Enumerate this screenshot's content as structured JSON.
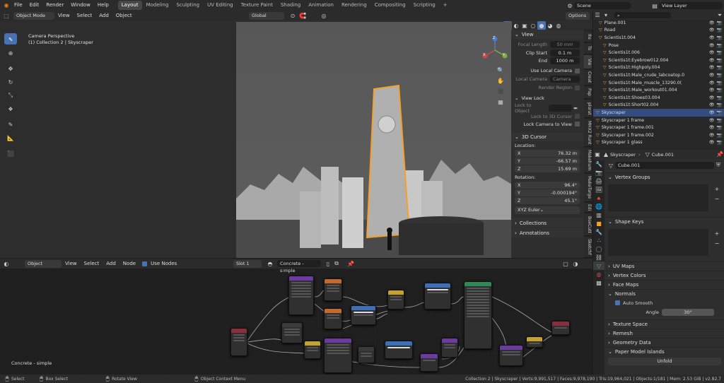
{
  "app_menu": [
    "File",
    "Edit",
    "Render",
    "Window",
    "Help"
  ],
  "workspace_tabs": [
    "Layout",
    "Modeling",
    "Sculpting",
    "UV Editing",
    "Texture Paint",
    "Shading",
    "Animation",
    "Rendering",
    "Compositing",
    "Scripting"
  ],
  "active_workspace": "Layout",
  "scene_name": "Scene",
  "view_layer": "View Layer",
  "viewport_header": {
    "mode": "Object Mode",
    "menus": [
      "View",
      "Select",
      "Add",
      "Object"
    ],
    "transform_orientation": "Global",
    "options": "Options"
  },
  "viewport_overlay": {
    "line1": "Camera Perspective",
    "line2": "(1) Collection 2 | Skyscraper"
  },
  "gizmo_axes": [
    "X",
    "Y",
    "Z"
  ],
  "n_panel": {
    "view_header": "View",
    "focal_length_label": "Focal Length",
    "focal_length": "50 mm",
    "clip_start_label": "Clip Start",
    "clip_start": "0.1 m",
    "end_label": "End",
    "end": "1000 m",
    "use_local_camera": "Use Local Camera",
    "local_camera_label": "Local Camera",
    "local_camera_value": "Camera",
    "render_region": "Render Region",
    "view_lock_header": "View Lock",
    "lock_to_object": "Lock to Object",
    "lock_to_3d_cursor": "Lock to 3D Cursor",
    "lock_camera_to_view": "Lock Camera to View",
    "cursor_header": "3D Cursor",
    "location_label": "Location:",
    "loc_x_label": "X",
    "loc_x": "76.32 m",
    "loc_y_label": "Y",
    "loc_y": "-66.57 m",
    "loc_z_label": "Z",
    "loc_z": "15.69 m",
    "rotation_label": "Rotation:",
    "rot_x_label": "X",
    "rot_x": "96.4°",
    "rot_y_label": "Y",
    "rot_y": "-0.000194°",
    "rot_z_label": "Z",
    "rot_z": "45.1°",
    "rotation_mode": "XYZ Euler",
    "collections": "Collections",
    "annotations": "Annotations"
  },
  "n_panel_tabs": [
    "Ite",
    "To",
    "Vie",
    "Creat",
    "Pap",
    "plorat",
    "MHX2 Runt",
    "Makehum",
    "MakeTarge",
    "Edi",
    "BoxCutt",
    "Sketchf"
  ],
  "outliner_rows": [
    {
      "name": "Plane.001",
      "sel": false
    },
    {
      "name": "Road",
      "sel": false
    },
    {
      "name": "Scientis1t.004",
      "sel": false
    },
    {
      "name": "Pose",
      "sel": false
    },
    {
      "name": "Scientis1t.006",
      "sel": false
    },
    {
      "name": "Scientis1t:Eyebrow012.004",
      "sel": false
    },
    {
      "name": "Scientis1t:Highpoly.004",
      "sel": false
    },
    {
      "name": "Scientis1t:Male_crude_labcoatop.0",
      "sel": false
    },
    {
      "name": "Scientis1t:Male_muscle_13290.0(",
      "sel": false
    },
    {
      "name": "Scientis1t:Male_workout01.004",
      "sel": false
    },
    {
      "name": "Scientis1t:Shoes03.004",
      "sel": false
    },
    {
      "name": "Scientis1t:Short02.004",
      "sel": false
    },
    {
      "name": "Skyscraper",
      "sel": true
    },
    {
      "name": "Skyscraper 1 frame",
      "sel": false
    },
    {
      "name": "Skyscraper 1 frame.001",
      "sel": false
    },
    {
      "name": "Skyscraper 1 frame.002",
      "sel": false
    },
    {
      "name": "Skyscraper 1 glass",
      "sel": false
    }
  ],
  "properties": {
    "object_name": "Skyscraper",
    "mesh_name": "Cube.001",
    "data_field": "Cube.001",
    "sections_top": [
      "Vertex Groups",
      "Shape Keys"
    ],
    "sections_mid": [
      "UV Maps",
      "Vertex Colors",
      "Face Maps",
      "Normals"
    ],
    "auto_smooth": "Auto Smooth",
    "angle_label": "Angle",
    "angle_value": "30°",
    "sections_bottom": [
      "Texture Space",
      "Remesh",
      "Geometry Data",
      "Paper Model Islands"
    ],
    "unfold_button": "Unfold"
  },
  "node_editor": {
    "object_menu": "Object",
    "menus": [
      "View",
      "Select",
      "Add",
      "Node"
    ],
    "use_nodes": "Use Nodes",
    "slot": "Slot 1",
    "material": "Concrete - simple",
    "overlay_label": "Concrete - simple"
  },
  "status_bar": {
    "select": "Select",
    "box_select": "Box Select",
    "rotate_view": "Rotate View",
    "context_menu": "Object Context Menu",
    "stats": "Collection 2 | Skyscraper | Verts:9,991,517 | Faces:9,978,190 | Tris:19,964,021 | Objects:1/181 | Mem: 2.53 GiB | v2.82.7"
  },
  "colors": {
    "accent": "#4772b3",
    "selected_outline": "#f4a02a",
    "header": "#2b2b2b"
  }
}
